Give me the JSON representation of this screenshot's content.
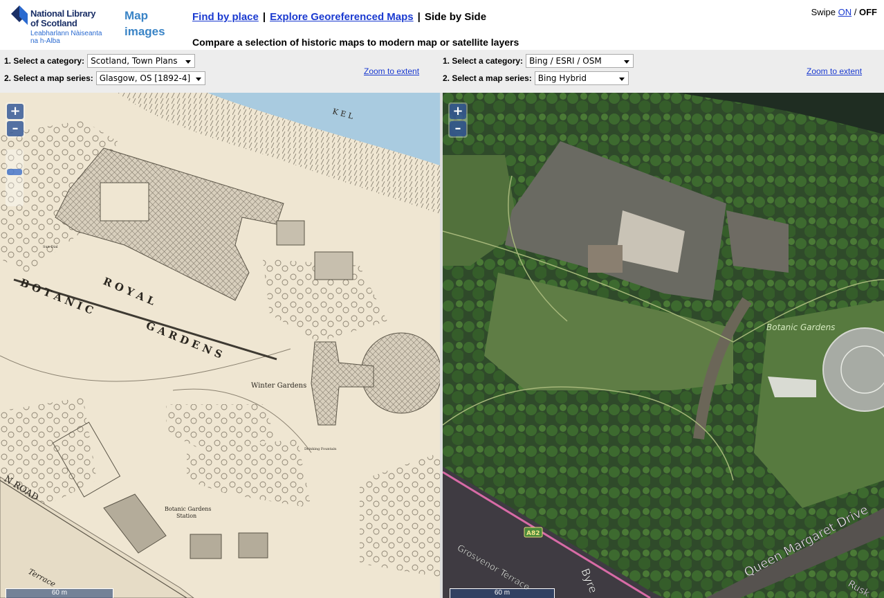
{
  "header": {
    "logo": {
      "line1": "National Library",
      "line2": "of Scotland",
      "line3": "Leabharlann Nàiseanta",
      "line4": "na h-Alba"
    },
    "app_title_line1": "Map",
    "app_title_line2": "images",
    "nav": {
      "find_by_place": "Find by place",
      "explore": "Explore Georeferenced Maps",
      "separator": "|",
      "current": "Side by Side"
    },
    "subtitle": "Compare a selection of historic maps to modern map or satellite layers",
    "swipe": {
      "label": "Swipe",
      "on": "ON",
      "slash": "/",
      "off": "OFF"
    }
  },
  "left_controls": {
    "category_label": "1. Select a category:",
    "category_value": "Scotland, Town Plans",
    "series_label": "2. Select a map series:",
    "series_value": "Glasgow, OS [1892-4]",
    "zoom_link": "Zoom to extent"
  },
  "right_controls": {
    "category_label": "1. Select a category:",
    "category_value": "Bing / ESRI / OSM",
    "series_label": "2. Select a map series:",
    "series_value": "Bing Hybrid",
    "zoom_link": "Zoom to extent"
  },
  "left_map": {
    "labels": {
      "royal": "R O Y A L",
      "botanic": "B O T A N I C",
      "gardens": "G A R D E N S",
      "winter_gardens": "Winter Gardens",
      "station_line1": "Botanic Gardens",
      "station_line2": "Station",
      "road": "N  ROAD",
      "terrace": "Terrace",
      "kelvin": "K E L",
      "drinking_fountain": "Drinking Fountain",
      "sun_dial": "Sun Dial"
    },
    "zoom_in": "+",
    "zoom_out": "–",
    "scale": "60 m"
  },
  "right_map": {
    "labels": {
      "botanic_gardens": "Botanic Gardens",
      "queen_margaret": "Queen Margaret Drive",
      "grosvenor": "Grosvenor Terrace",
      "byres": "Byre",
      "ruskin": "Rusk",
      "a82": "A82"
    },
    "zoom_in": "+",
    "zoom_out": "–",
    "scale": "60 m"
  },
  "colors": {
    "link": "#1a3ad0",
    "title_blue": "#3a84c6",
    "logo_navy": "#1a2f66",
    "controls_bg": "#ededed",
    "old_map_paper": "#efe6d2",
    "satellite_green": "#3f5a36"
  }
}
